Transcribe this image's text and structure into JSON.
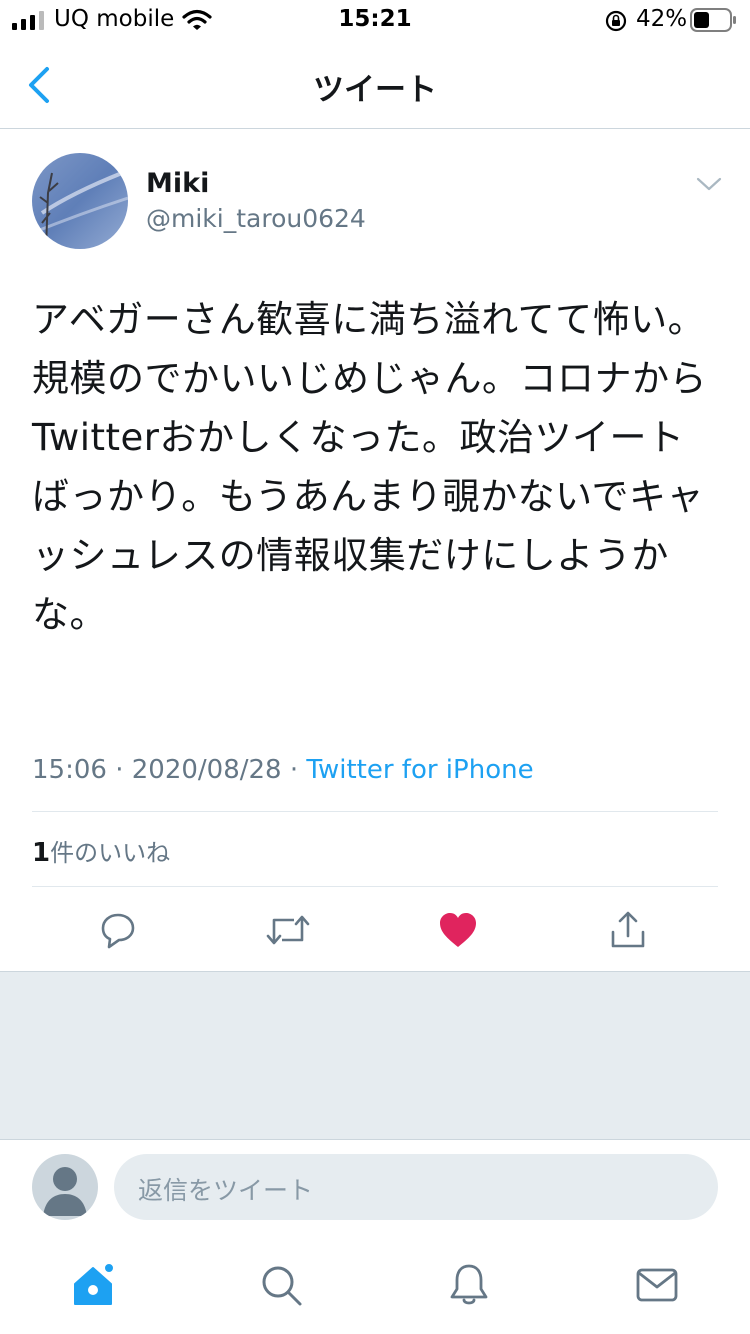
{
  "status_bar": {
    "carrier": "UQ mobile",
    "time": "15:21",
    "battery": "42%"
  },
  "nav": {
    "back_icon": "chevron-left-icon",
    "title": "ツイート"
  },
  "tweet": {
    "name": "Miki",
    "handle": "@miki_tarou0624",
    "text": "アベガーさん歓喜に満ち溢れてて怖い。\n規模のでかいいじめじゃん。コロナからTwitterおかしくなった。政治ツイートばっかり。もうあんまり覗かないでキャッシュレスの情報収集だけにしようかな。",
    "time": "15:06",
    "separator": "·",
    "date": "2020/08/28",
    "source": "Twitter for iPhone",
    "likes_count": "1",
    "likes_label": "件のいいね",
    "liked": true
  },
  "actions": [
    "reply-icon",
    "retweet-icon",
    "like-icon",
    "share-icon"
  ],
  "reply": {
    "placeholder": "返信をツイート"
  },
  "tabs": [
    "home-icon",
    "search-icon",
    "notifications-icon",
    "messages-icon"
  ],
  "colors": {
    "accent": "#1da1f2",
    "like": "#e0245e",
    "muted": "#657786"
  }
}
